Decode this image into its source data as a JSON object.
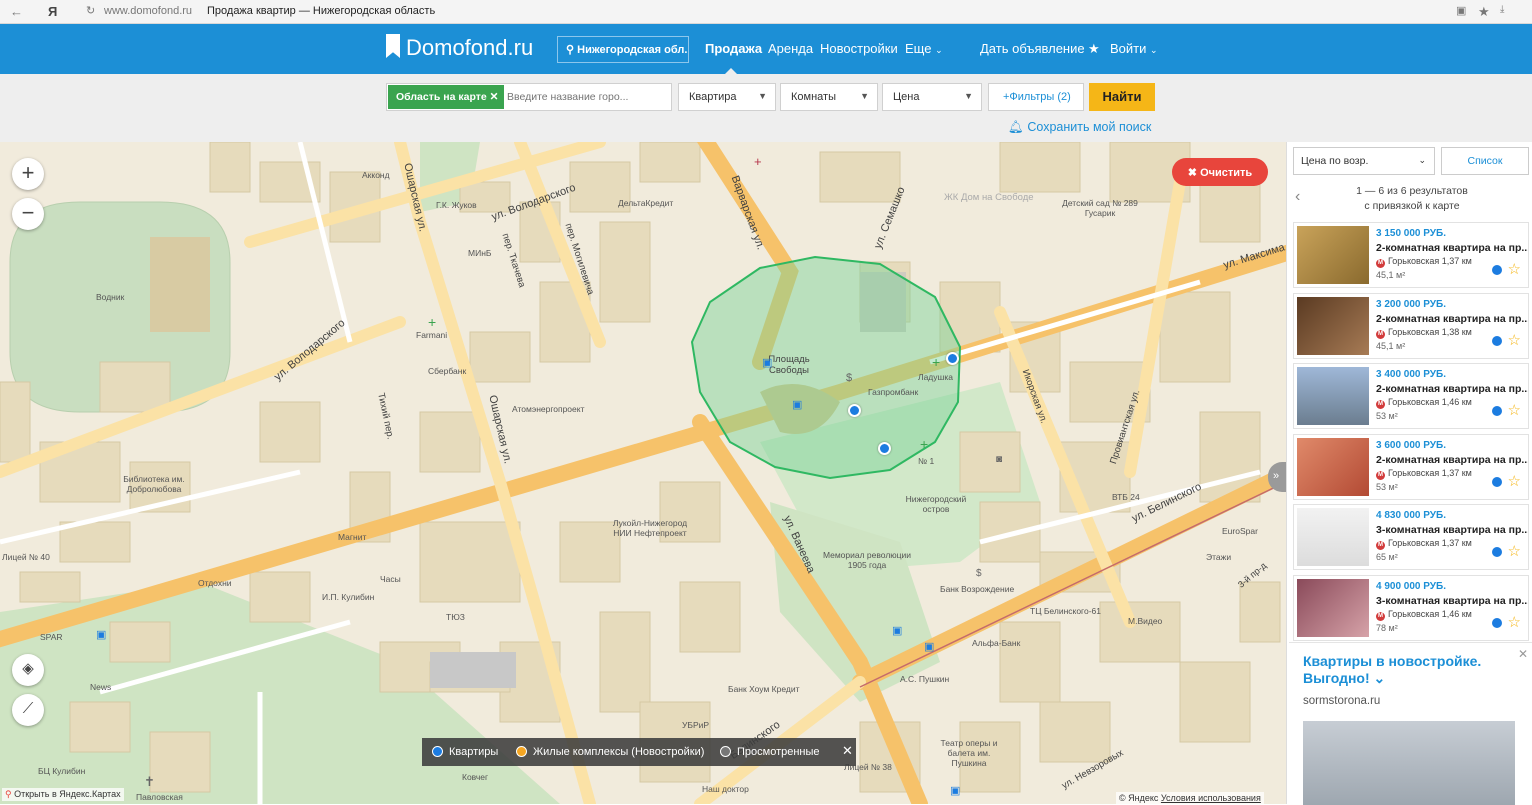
{
  "browser": {
    "back_icon": "arrow-left-icon",
    "yandex_letter": "Я",
    "url": "www.domofond.ru",
    "page_title": "Продажа квартир — Нижегородская область"
  },
  "header": {
    "logo": "Domofond.ru",
    "region": "Нижегородская обл..",
    "nav": {
      "sale": "Продажа",
      "rent": "Аренда",
      "new": "Новостройки",
      "more": "Еще",
      "add": "Дать объявление",
      "login": "Войти"
    }
  },
  "filters": {
    "area_chip": "Область на карте",
    "city_placeholder": "Введите название горо...",
    "type": "Квартира",
    "rooms": "Комнаты",
    "price": "Цена",
    "more_filters": "+Фильтры (2)",
    "find": "Найти",
    "save_search": "Сохранить мой поиск"
  },
  "map": {
    "clear": "Очистить",
    "zoom_in": "+",
    "zoom_out": "−",
    "legend": {
      "flats": "Квартиры",
      "complexes": "Жилые комплексы (Новостройки)",
      "viewed": "Просмотренные"
    },
    "open_yandex": "Открыть в Яндекс.Картах",
    "copyright": "© Яндекс",
    "terms": "Условия использования",
    "streets": {
      "varvarskaya": "Варварская ул.",
      "semashko": "ул. Семашко",
      "maksima": "ул. Максима",
      "osharskaya1": "Ошарская ул.",
      "osharskaya2": "Ошарская ул.",
      "volodarskogo1": "ул. Володарского",
      "volodarskogo2": "ул. Володарского",
      "tkacheva": "пер. Ткачева",
      "mogilevicha": "пер. Могилевича",
      "tikhiy": "Тихий пер.",
      "vaneeva": "ул. Ванеева",
      "belinskogo": "ул. Белинского",
      "ikorskaya": "Икорская ул.",
      "provientskaya": "Провиантская ул.",
      "belinskogo_bottom": "Белинского",
      "nevzorovykh": "ул. Невзоровых",
      "third_pr": "3-й пр-д"
    },
    "places": {
      "ploshchad": "Площадь Свободы",
      "gazprombank": "Газпромбанк",
      "ladushka": "Ладушка",
      "n1": "№ 1",
      "nizhny_island": "Нижегородский остров",
      "memorial": "Мемориал революции 1905 года",
      "bank_vozr": "Банк Возрождение",
      "tc_bel": "ТЦ Белинского-61",
      "mvideo": "М.Видео",
      "alfa": "Альфа-Банк",
      "pushkin": "А.С. Пушкин",
      "teatr": "Театр оперы и балета им. Пушкина",
      "liceum": "Лицей № 38",
      "nash_doctor": "Наш доктор",
      "bank_houm": "Банк Хоум Кредит",
      "ubrir": "УБРиР",
      "kovcheg": "Ковчег",
      "tyuz": "ТЮЗ",
      "chasy": "Часы",
      "kulibin": "И.П. Кулибин",
      "bc_kulibin": "БЦ Кулибин",
      "news": "News",
      "spar": "SPAR",
      "otdokhni": "Отдохни",
      "magnit": "Магнит",
      "lukoil": "Лукойл-Нижегород НИИ Нефтепроект",
      "biblioteka": "Библиотека им. Добролюбова",
      "atomenergo": "Атомэнергопроект",
      "sberbank": "Сбербанк",
      "farmani": "Farmani",
      "minb": "МИнБ",
      "vodnik": "Водник",
      "akkond": "Акконд",
      "gk_zhukov": "Г.К. Жуков",
      "deltakredit": "ДельтаКредит",
      "zhk": "ЖК Дом на Свободе",
      "detsad": "Детский сад № 289 Гусарик",
      "vtb": "ВТБ 24",
      "eurospar": "EuroSpar",
      "etazhi": "Этажи",
      "lyceum40": "Лицей № 40",
      "pavlovskaya": "Павловская"
    }
  },
  "results": {
    "sort": "Цена по возр.",
    "list_btn": "Список",
    "info_line1": "1 — 6 из 6 результатов",
    "info_line2": "с привязкой к карте",
    "listings": [
      {
        "price": "3 150 000 РУБ.",
        "title": "2-комнатная квартира на пр...",
        "metro": "Горьковская 1,37 км",
        "area": "45,1 м²"
      },
      {
        "price": "3 200 000 РУБ.",
        "title": "2-комнатная квартира на пр...",
        "metro": "Горьковская 1,38 км",
        "area": "45,1 м²"
      },
      {
        "price": "3 400 000 РУБ.",
        "title": "2-комнатная квартира на пр...",
        "metro": "Горьковская 1,46 км",
        "area": "53 м²"
      },
      {
        "price": "3 600 000 РУБ.",
        "title": "2-комнатная квартира на пр...",
        "metro": "Горьковская 1,37 км",
        "area": "53 м²"
      },
      {
        "price": "4 830 000 РУБ.",
        "title": "3-комнатная квартира на пр...",
        "metro": "Горьковская 1,37 км",
        "area": "65 м²"
      },
      {
        "price": "4 900 000 РУБ.",
        "title": "3-комнатная квартира на пр...",
        "metro": "Горьковская 1,46 км",
        "area": "78 м²"
      }
    ],
    "metro_letter": "М",
    "star": "☆"
  },
  "ad": {
    "headline": "Квартиры в новостройке. Выгодно!",
    "domain": "sormstorona.ru"
  },
  "colors": {
    "brand_blue": "#1c8fd6",
    "find_yellow": "#f5b617",
    "area_green": "#3aa44f",
    "clear_red": "#e8453c",
    "pin_blue": "#1c7ce0"
  }
}
